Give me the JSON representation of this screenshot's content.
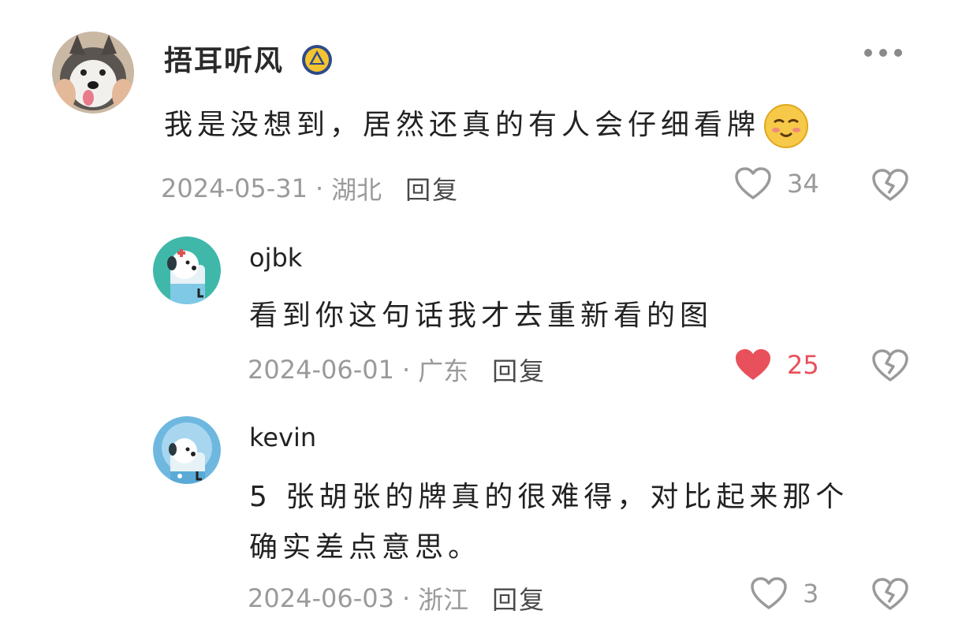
{
  "comments": [
    {
      "user": "捂耳听风",
      "text": "我是没想到，居然还真的有人会仔细看牌",
      "date": "2024-05-31",
      "location": "湖北",
      "reply_label": "回复",
      "likes": "34",
      "liked": false
    },
    {
      "user": "ojbk",
      "text": "看到你这句话我才去重新看的图",
      "date": "2024-06-01",
      "location": "广东",
      "reply_label": "回复",
      "likes": "25",
      "liked": true
    },
    {
      "user": "kevin",
      "text_line1": "5 张胡张的牌真的很难得，对比起来那个",
      "text_line2": "确实差点意思。",
      "date": "2024-06-03",
      "location": "浙江",
      "reply_label": "回复",
      "likes": "3",
      "liked": false
    }
  ],
  "colors": {
    "like_active": "#e8505b",
    "meta_gray": "#9a9a9a"
  }
}
